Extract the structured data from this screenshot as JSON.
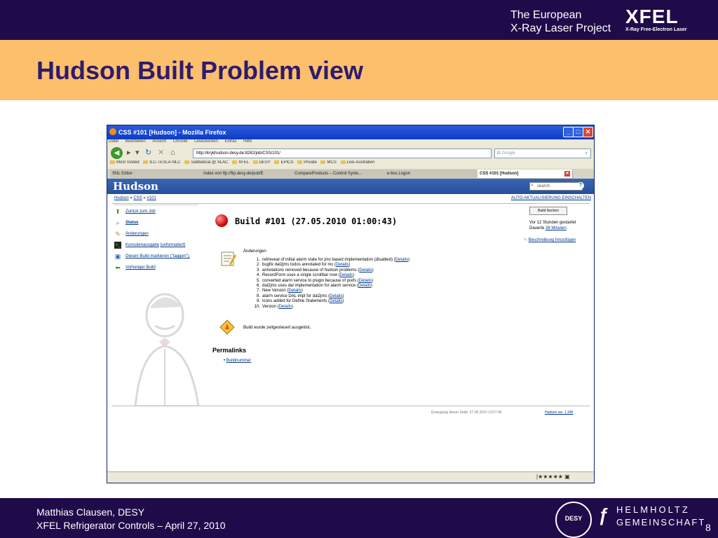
{
  "slide": {
    "project_line1": "The European",
    "project_line2": "X-Ray Laser Project",
    "logo_text": "XFEL",
    "logo_sub": "X-Ray Free-Electron Laser",
    "title": "Hudson Built Problem view",
    "footer_line1": "Matthias Clausen, DESY",
    "footer_line2": "XFEL Refrigerator Controls – April 27, 2010",
    "desy_logo": "DESY",
    "helmholtz_line1": "HELMHOLTZ",
    "helmholtz_line2": "GEMEINSCHAFT",
    "page_number": "8",
    "colors": {
      "navy": "#1f0a4a",
      "orange": "#fcbf6c",
      "title": "#2d1b6e"
    }
  },
  "browser": {
    "window_title": "CSS #101 [Hudson] - Mozilla Firefox",
    "menu": [
      "Datei",
      "Bearbeiten",
      "Ansicht",
      "Chronik",
      "Lesezeichen",
      "Extras",
      "Hilfe"
    ],
    "url": "http://krykhudson.desy.de:8282/job/CSS/101/",
    "search_placeholder": "Google",
    "bookmarks": [
      "Most Visited",
      "ILC-TESLA-NLC",
      "Sabbatical @ SLAC",
      "XFEL",
      "DESY",
      "EPICS",
      "Private",
      "MCS",
      "Live-Australien"
    ],
    "tabs": [
      {
        "label": "SNL Editor",
        "active": false
      },
      {
        "label": "Index von ftp://ftp.desy.de/pub/E",
        "active": false
      },
      {
        "label": "CompareProducts – Control Syste...",
        "active": false
      },
      {
        "label": "e-bss Logon",
        "active": false
      },
      {
        "label": "CSS #101 [Hudson]",
        "active": true
      }
    ]
  },
  "hudson": {
    "logo": "Hudson",
    "search_placeholder": "search",
    "breadcrumb": [
      "Hudson",
      "CSS",
      "#101"
    ],
    "breadcrumb_sep": "»",
    "auto_refresh": "AUTO-AKTUALISIERUNG EINSCHALTEN",
    "sidebar": [
      {
        "label": "Zurück zum Job",
        "icon": "arrow-up-icon"
      },
      {
        "label": "Status",
        "icon": "magnifier-icon"
      },
      {
        "label": "Änderungen",
        "icon": "notepad-icon"
      },
      {
        "label": "Konsolenausgabe",
        "extra": "[unformatiert]",
        "icon": "terminal-icon"
      },
      {
        "label": "Diesen Build markieren (\"taggen\").",
        "icon": "tag-icon"
      },
      {
        "label": "Vorheriger Build",
        "icon": "arrow-left-icon"
      }
    ],
    "build_title": "Build #101 (27.05.2010 01:00:43)",
    "delete_button": "Build löschen",
    "since_line1": "Vor 12 Stunden gestartet",
    "since_line2": "Dauerte",
    "duration": "38 Minuten",
    "add_description": "Beschreibung hinzufügen",
    "changes_label": "Änderungen",
    "details_label": "Details",
    "changes": [
      "retrieveal of initial alarm state for jms based implementation (disabled) (",
      "bugfix dal2jms todos annotated for mc (",
      "annotations removed because of hudson problems (",
      "RecordForm uses a single scrollbar now (",
      "converted alarm service to plugin because of prefs (",
      "dal2jms uses dal implementation for alarm service (",
      "New Version (",
      "alarm service DAL impl for dal2jms (",
      "Icons added for Define Statements (",
      "Version ("
    ],
    "triggered": "Build wurde zeitgesteuert ausgelöst.",
    "permalinks_title": "Permalinks",
    "permalinks": [
      "Buildnummer"
    ],
    "footer_generated": "Erzeugung dieser Seite: 27.05.2010 13:57:46",
    "footer_version": "Hudson ver. 1.345"
  }
}
